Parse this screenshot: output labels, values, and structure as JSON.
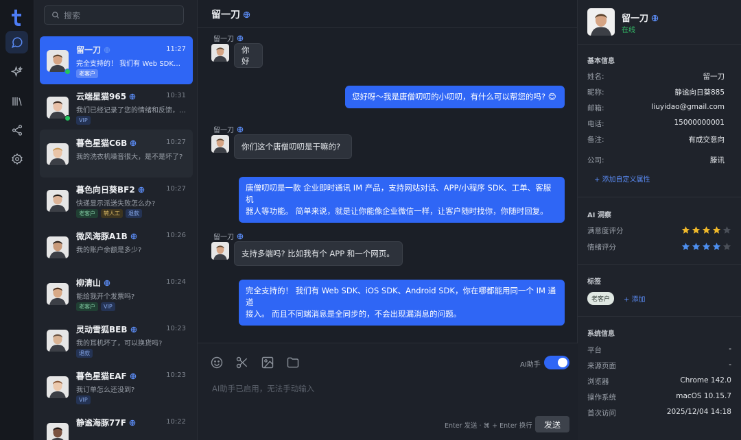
{
  "rail": {
    "items": [
      {
        "name": "chat",
        "active": true
      },
      {
        "name": "ai-sparkle"
      },
      {
        "name": "library"
      },
      {
        "name": "share"
      },
      {
        "name": "settings"
      }
    ]
  },
  "search": {
    "placeholder": "搜索"
  },
  "conversations": [
    {
      "name": "留一刀",
      "time": "11:27",
      "preview": "完全支持的！ 我们有 Web SDK、iOS SDK、Android SDK…",
      "tags": [
        {
          "label": "老客户",
          "color": "white"
        }
      ],
      "online": true,
      "active": true,
      "skin": "#d6a585",
      "hair": "#5a4430"
    },
    {
      "name": "云端星猫965",
      "time": "10:31",
      "preview": "我们已经记录了您的情绪和反馈，会尽快处理",
      "tags": [
        {
          "label": "VIP",
          "color": "blue"
        }
      ],
      "online": true,
      "skin": "#e8c0a8",
      "hair": "#3b2a22"
    },
    {
      "name": "暮色星猫C6B",
      "time": "10:27",
      "preview": "我的洗衣机噪音很大，是不是坏了?",
      "tags": [],
      "hover": true,
      "skin": "#e9c4a7",
      "hair": "#c99a58"
    },
    {
      "name": "暮色向日葵BF2",
      "time": "10:27",
      "preview": "快递显示派送失败怎么办?",
      "tags": [
        {
          "label": "老客户",
          "color": "green"
        },
        {
          "label": "转人工",
          "color": "yellow"
        },
        {
          "label": "退款",
          "color": "blue"
        }
      ],
      "skin": "#ddb498",
      "hair": "#1e1a18"
    },
    {
      "name": "微风海豚A1B",
      "time": "10:26",
      "preview": "我的账户余额是多少?",
      "tags": [],
      "skin": "#c89a7a",
      "hair": "#2a201a"
    },
    {
      "name": "柳清山",
      "time": "10:24",
      "preview": "能给我开个发票吗?",
      "tags": [
        {
          "label": "老客户",
          "color": "green"
        },
        {
          "label": "VIP",
          "color": "blue"
        }
      ],
      "skin": "#d8a986",
      "hair": "#4a2f1e"
    },
    {
      "name": "灵动雪狐BEB",
      "time": "10:23",
      "preview": "我的耳机坏了，可以换货吗?",
      "tags": [
        {
          "label": "退款",
          "color": "blue"
        }
      ],
      "skin": "#d9b394",
      "hair": "#6b5646"
    },
    {
      "name": "暮色星猫EAF",
      "time": "10:23",
      "preview": "我订单怎么还没到?",
      "tags": [
        {
          "label": "VIP",
          "color": "blue"
        }
      ],
      "skin": "#ecc9ad",
      "hair": "#8a5a3a"
    },
    {
      "name": "静谧海豚77F",
      "time": "10:22",
      "preview": "",
      "tags": [],
      "skin": "#7a5240",
      "hair": "#1c1512"
    }
  ],
  "chat": {
    "title": "留一刀",
    "messages": [
      {
        "dir": "in",
        "sender": "留一刀",
        "text": "你好"
      },
      {
        "dir": "out",
        "text": "您好呀～我是唐僧叨叨的小叨叨，有什么可以帮您的吗? 😊"
      },
      {
        "dir": "in",
        "sender": "留一刀",
        "text": "你们这个唐僧叨叨是干嘛的?"
      },
      {
        "dir": "out",
        "lines": [
          "唐僧叨叨是一款 企业即时通讯 IM 产品，支持网站对话、APP/小程序 SDK、工单、客服机",
          "器人等功能。 简单来说，就是让你能像企业微信一样，让客户随时找你，你随时回复。"
        ]
      },
      {
        "dir": "in",
        "sender": "留一刀",
        "text": "支持多端吗? 比如我有个 APP 和一个网页。"
      },
      {
        "dir": "out",
        "lines": [
          "完全支持的！ 我们有 Web SDK、iOS SDK、Android SDK，你在哪都能用同一个 IM 通道",
          "接入。 而且不同端消息是全同步的，不会出现漏消息的问题。"
        ]
      }
    ],
    "composer": {
      "ai_label": "AI助手",
      "ai_enabled": true,
      "hint": "AI助手已启用，无法手动输入",
      "shortcut": "Enter 发送 · ⌘ + Enter 换行",
      "send": "发送"
    }
  },
  "profile": {
    "name": "留一刀",
    "status": "在线",
    "basic_title": "基本信息",
    "fields": [
      {
        "k": "姓名:",
        "v": "留一刀"
      },
      {
        "k": "昵称:",
        "v": "静谧向日葵885"
      },
      {
        "k": "邮箱:",
        "v": "liuyidao@gmail.com"
      },
      {
        "k": "电话:",
        "v": "15000000001"
      },
      {
        "k": "备注:",
        "v": "有成交意向"
      },
      {
        "k": "公司:",
        "v": "滕讯"
      }
    ],
    "add_custom": "+ 添加自定义属性",
    "ai_title": "AI 洞察",
    "ratings": [
      {
        "label": "满意度评分",
        "value": 4,
        "max": 5,
        "color": "#f0b92a"
      },
      {
        "label": "情绪评分",
        "value": 4,
        "max": 5,
        "color": "#4d8ff0"
      }
    ],
    "tags_title": "标签",
    "tags": [
      "老客户"
    ],
    "add_tag": "+ 添加",
    "sys_title": "系统信息",
    "sys": [
      {
        "k": "平台",
        "v": "-"
      },
      {
        "k": "来源页面",
        "v": "-"
      },
      {
        "k": "浏览器",
        "v": "Chrome 142.0"
      },
      {
        "k": "操作系统",
        "v": "macOS 10.15.7"
      },
      {
        "k": "首次访问",
        "v": "2025/12/04 14:18"
      }
    ]
  }
}
